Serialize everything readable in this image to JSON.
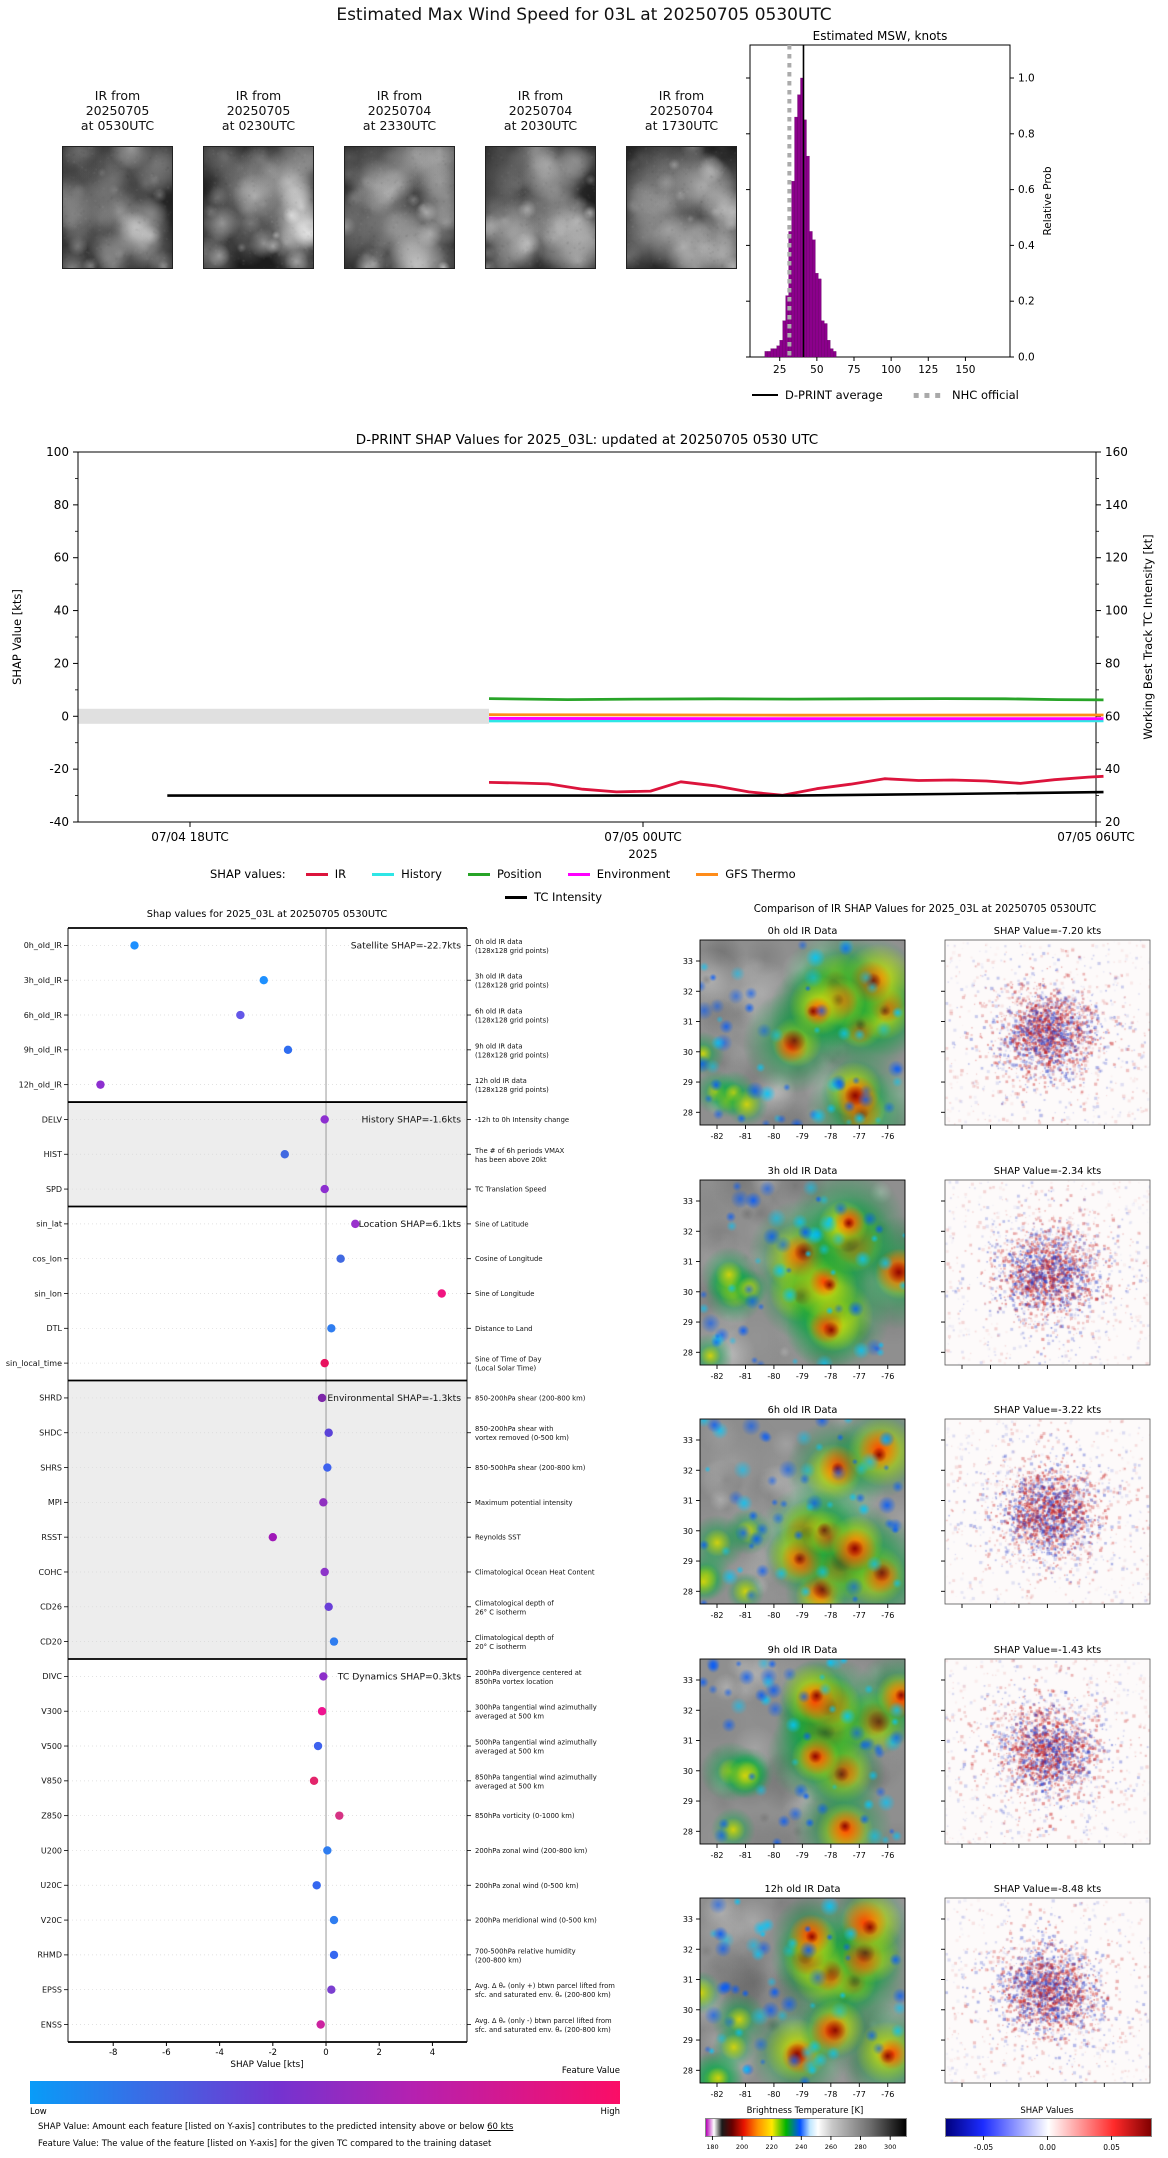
{
  "page": {
    "title": "Estimated Max Wind Speed for 03L at 20250705 0530UTC"
  },
  "ir_thumbnails": {
    "items": [
      {
        "lines": [
          "IR from",
          "20250705",
          "at 0530UTC"
        ]
      },
      {
        "lines": [
          "IR from",
          "20250705",
          "at 0230UTC"
        ]
      },
      {
        "lines": [
          "IR from",
          "20250704",
          "at 2330UTC"
        ]
      },
      {
        "lines": [
          "IR from",
          "20250704",
          "at 2030UTC"
        ]
      },
      {
        "lines": [
          "IR from",
          "20250704",
          "at 1730UTC"
        ]
      }
    ]
  },
  "chart_data": [
    {
      "id": "msw_histogram",
      "type": "bar",
      "title": "Estimated MSW, knots",
      "ylabel": "Relative Prob",
      "xlim": [
        5,
        180
      ],
      "ylim": [
        0,
        1.12
      ],
      "xticks": [
        25,
        50,
        75,
        100,
        125,
        150
      ],
      "yticks": [
        0.0,
        0.2,
        0.4,
        0.6,
        0.8,
        1.0
      ],
      "bar_color": "#8B008B",
      "bin_width_kts": 2,
      "bins_kts": [
        16,
        18,
        20,
        22,
        24,
        26,
        28,
        30,
        32,
        34,
        36,
        38,
        40,
        42,
        44,
        46,
        48,
        50,
        52,
        54,
        56,
        58,
        60,
        62
      ],
      "rel_prob": [
        0.02,
        0.02,
        0.03,
        0.03,
        0.04,
        0.06,
        0.13,
        0.22,
        0.45,
        0.63,
        0.86,
        0.94,
        1.0,
        0.85,
        0.72,
        0.45,
        0.42,
        0.3,
        0.28,
        0.13,
        0.12,
        0.06,
        0.03,
        0.02
      ],
      "dprint_average_kts": 41,
      "nhc_official_kts": 31.5,
      "legend": [
        {
          "label": "D-PRINT average",
          "style": "solid-black-line"
        },
        {
          "label": "NHC official",
          "style": "gray-square-dashes"
        }
      ]
    },
    {
      "id": "shap_timeseries",
      "type": "line",
      "title": "D-PRINT SHAP Values for 2025_03L: updated at 20250705 0530 UTC",
      "ylabel_left": "SHAP Value [kts]",
      "ylabel_right": "Working Best Track TC Intensity [kt]",
      "xlabel": "2025",
      "ylim_left": [
        -40,
        100
      ],
      "yticks_left": [
        100,
        80,
        60,
        40,
        20,
        0,
        -20,
        -40
      ],
      "ylim_right": [
        20,
        160
      ],
      "yticks_right": [
        160,
        140,
        120,
        100,
        80,
        60,
        40,
        20
      ],
      "xtick_labels": [
        "07/04 18UTC",
        "07/05 00UTC",
        "07/05 06UTC"
      ],
      "xtick_hours": [
        0,
        6,
        12
      ],
      "zero_band": {
        "color": "#e0e0e0",
        "from_h": -1.5,
        "to_h": 3.96
      },
      "legend_label": "SHAP values:",
      "series": [
        {
          "name": "IR",
          "color": "#DC143C",
          "axis": "left",
          "x_h": [
            3.96,
            4.3,
            4.75,
            5.2,
            5.65,
            6.1,
            6.5,
            6.95,
            7.4,
            7.85,
            8.3,
            8.75,
            9.2,
            9.65,
            10.1,
            10.55,
            11.0,
            11.45,
            11.9,
            12.1
          ],
          "values": [
            -25.0,
            -25.2,
            -25.6,
            -27.6,
            -28.6,
            -28.3,
            -24.8,
            -26.3,
            -28.6,
            -29.9,
            -27.4,
            -25.7,
            -23.6,
            -24.3,
            -24.1,
            -24.5,
            -25.4,
            -24.0,
            -23.0,
            -22.7
          ]
        },
        {
          "name": "History",
          "color": "#2ee6e6",
          "axis": "left",
          "x_h": [
            3.96,
            8.0,
            12.1
          ],
          "values": [
            -1.8,
            -1.7,
            -1.7
          ]
        },
        {
          "name": "Position",
          "color": "#28a428",
          "axis": "left",
          "x_h": [
            3.96,
            5.0,
            6.0,
            7.0,
            8.0,
            9.0,
            10.0,
            10.8,
            11.5,
            12.1
          ],
          "values": [
            6.7,
            6.3,
            6.5,
            6.6,
            6.5,
            6.6,
            6.7,
            6.6,
            6.3,
            6.2
          ]
        },
        {
          "name": "Environment",
          "color": "#ff00ff",
          "axis": "left",
          "x_h": [
            3.96,
            8.0,
            12.1
          ],
          "values": [
            -0.8,
            -0.9,
            -0.9
          ]
        },
        {
          "name": "GFS Thermo",
          "color": "#ff8c1a",
          "axis": "left",
          "x_h": [
            3.96,
            8.0,
            12.1
          ],
          "values": [
            0.6,
            0.4,
            0.5
          ]
        },
        {
          "name": "TC Intensity",
          "color": "#000000",
          "axis": "right",
          "x_h": [
            -0.3,
            6.0,
            8.0,
            10.0,
            12.1
          ],
          "values": [
            30,
            30,
            30,
            30.6,
            31.3
          ]
        }
      ]
    },
    {
      "id": "shap_dotplot",
      "type": "scatter",
      "title": "Shap values for 2025_03L at 20250705 0530UTC",
      "xlabel": "SHAP Value [kts]",
      "xticks": [
        -8,
        -6,
        -4,
        -2,
        0,
        2,
        4
      ],
      "xlim": [
        -9.7,
        5.3
      ],
      "sections": [
        {
          "label": "Satellite SHAP=-22.7kts",
          "shaded": false,
          "features": [
            {
              "name": "0h_old_IR",
              "value": -7.2,
              "color": "#1e90ff",
              "desc": [
                "0h old IR data",
                "(128x128 grid points)"
              ]
            },
            {
              "name": "3h_old_IR",
              "value": -2.34,
              "color": "#1e90ff",
              "desc": [
                "3h old IR data",
                "(128x128 grid points)"
              ]
            },
            {
              "name": "6h_old_IR",
              "value": -3.22,
              "color": "#6457e8",
              "desc": [
                "6h old IR data",
                "(128x128 grid points)"
              ]
            },
            {
              "name": "9h_old_IR",
              "value": -1.43,
              "color": "#2f6df0",
              "desc": [
                "9h old IR data",
                "(128x128 grid points)"
              ]
            },
            {
              "name": "12h_old_IR",
              "value": -8.48,
              "color": "#8d2fd0",
              "desc": [
                "12h old IR data",
                "(128x128 grid points)"
              ]
            }
          ]
        },
        {
          "label": "History SHAP=-1.6kts",
          "shaded": true,
          "features": [
            {
              "name": "DELV",
              "value": -0.05,
              "color": "#8d2fd0",
              "desc": [
                "-12h to 0h Intensity change"
              ]
            },
            {
              "name": "HIST",
              "value": -1.55,
              "color": "#4169e1",
              "desc": [
                "The # of 6h periods VMAX",
                "has been above 20kt"
              ]
            },
            {
              "name": "SPD",
              "value": -0.05,
              "color": "#8d2fd0",
              "desc": [
                "TC Translation Speed"
              ]
            }
          ]
        },
        {
          "label": "Location SHAP=6.1kts",
          "shaded": false,
          "features": [
            {
              "name": "sin_lat",
              "value": 1.1,
              "color": "#9932cc",
              "desc": [
                "Sine of Latitude"
              ]
            },
            {
              "name": "cos_lon",
              "value": 0.55,
              "color": "#4169e1",
              "desc": [
                "Cosine of Longitude"
              ]
            },
            {
              "name": "sin_lon",
              "value": 4.35,
              "color": "#f01480",
              "desc": [
                "Sine of Longitude"
              ]
            },
            {
              "name": "DTL",
              "value": 0.2,
              "color": "#2f7df0",
              "desc": [
                "Distance to Land"
              ]
            },
            {
              "name": "sin_local_time",
              "value": -0.05,
              "color": "#e8125f",
              "desc": [
                "Sine of Time of Day",
                "(Local Solar Time)"
              ]
            }
          ]
        },
        {
          "label": "Environmental SHAP=-1.3kts",
          "shaded": true,
          "features": [
            {
              "name": "SHRD",
              "value": -0.15,
              "color": "#7d26a8",
              "desc": [
                "850-200hPa shear (200-800 km)"
              ]
            },
            {
              "name": "SHDC",
              "value": 0.1,
              "color": "#5b43d8",
              "desc": [
                "850-200hPa shear with",
                "vortex removed (0-500 km)"
              ]
            },
            {
              "name": "SHRS",
              "value": 0.05,
              "color": "#3e62ee",
              "desc": [
                "850-500hPa shear (200-800 km)"
              ]
            },
            {
              "name": "MPI",
              "value": -0.1,
              "color": "#9030c0",
              "desc": [
                "Maximum potential intensity"
              ]
            },
            {
              "name": "RSST",
              "value": -2.0,
              "color": "#a018b8",
              "desc": [
                "Reynolds SST"
              ]
            },
            {
              "name": "COHC",
              "value": -0.05,
              "color": "#8d35c9",
              "desc": [
                "Climatological Ocean Heat Content"
              ]
            },
            {
              "name": "CD26",
              "value": 0.1,
              "color": "#6a3fd8",
              "desc": [
                "Climatological depth of",
                "26° C isotherm"
              ]
            },
            {
              "name": "CD20",
              "value": 0.3,
              "color": "#2f7df0",
              "desc": [
                "Climatological depth of",
                "20° C isotherm"
              ]
            }
          ]
        },
        {
          "label": "TC Dynamics SHAP=0.3kts",
          "shaded": false,
          "features": [
            {
              "name": "DIVC",
              "value": -0.1,
              "color": "#8d2fc9",
              "desc": [
                "200hPa divergence centered at",
                "850hPa vortex location"
              ]
            },
            {
              "name": "V300",
              "value": -0.15,
              "color": "#ef1390",
              "desc": [
                "300hPa tangential wind azimuthally",
                "averaged at 500 km"
              ]
            },
            {
              "name": "V500",
              "value": -0.3,
              "color": "#3e62ee",
              "desc": [
                "500hPa tangential wind azimuthally",
                "averaged at 500 km"
              ]
            },
            {
              "name": "V850",
              "value": -0.45,
              "color": "#e3256b",
              "desc": [
                "850hPa tangential wind azimuthally",
                "averaged at 500 km"
              ]
            },
            {
              "name": "Z850",
              "value": 0.5,
              "color": "#d63384",
              "desc": [
                "850hPa vorticity (0-1000 km)"
              ]
            },
            {
              "name": "U200",
              "value": 0.05,
              "color": "#2f7df0",
              "desc": [
                "200hPa zonal wind (200-800 km)"
              ]
            },
            {
              "name": "U20C",
              "value": -0.35,
              "color": "#3567f0",
              "desc": [
                "200hPa zonal wind (0-500 km)"
              ]
            },
            {
              "name": "V20C",
              "value": 0.3,
              "color": "#2f7df0",
              "desc": [
                "200hPa meridional wind (0-500 km)"
              ]
            },
            {
              "name": "RHMD",
              "value": 0.3,
              "color": "#3567f0",
              "desc": [
                "700-500hPa relative humidity",
                "(200-800 km)"
              ]
            },
            {
              "name": "EPSS",
              "value": 0.2,
              "color": "#7b3fd0",
              "desc": [
                "Avg. Δ θₑ (only +) btwn parcel lifted from",
                "sfc. and saturated env. θₑ (200-800 km)"
              ]
            },
            {
              "name": "ENSS",
              "value": -0.2,
              "color": "#cc22a0",
              "desc": [
                "Avg. Δ θₑ (only -) btwn parcel lifted from",
                "sfc. and saturated env. θₑ (200-800 km)"
              ]
            }
          ]
        }
      ]
    },
    {
      "id": "ir_shap_comparison",
      "type": "heatmap",
      "title": "Comparison of IR SHAP Values for 2025_03L at 20250705 0530UTC",
      "lat_ticks": [
        33,
        32,
        31,
        30,
        29,
        28
      ],
      "lon_ticks": [
        -82,
        -81,
        -80,
        -79,
        -78,
        -77,
        -76
      ],
      "rows": [
        {
          "ir_title": "0h old IR Data",
          "shap_title": "SHAP Value=-7.20 kts"
        },
        {
          "ir_title": "3h old IR Data",
          "shap_title": "SHAP Value=-2.34 kts"
        },
        {
          "ir_title": "6h old IR Data",
          "shap_title": "SHAP Value=-3.22 kts"
        },
        {
          "ir_title": "9h old IR Data",
          "shap_title": "SHAP Value=-1.43 kts"
        },
        {
          "ir_title": "12h old IR Data",
          "shap_title": "SHAP Value=-8.48 kts"
        }
      ]
    }
  ],
  "feature_value_bar": {
    "title": "Feature Value",
    "low": "Low",
    "high": "High",
    "stops": [
      [
        "#089cf8",
        0
      ],
      [
        "#7433d0",
        42
      ],
      [
        "#b521b0",
        65
      ],
      [
        "#fb0d66",
        100
      ]
    ]
  },
  "footnotes": {
    "shap_prefix": "SHAP Value: Amount each feature [listed on Y-axis] contributes to the predicted intensity above or below ",
    "shap_underlined": "60 kts",
    "feature": "Feature Value: The value of the feature [listed on Y-axis] for the given TC compared to the training dataset"
  },
  "colorbars": {
    "brightness": {
      "title": "Brightness Temperature [K]",
      "range": [
        175,
        310
      ],
      "ticks": [
        180,
        200,
        220,
        240,
        260,
        280,
        300
      ],
      "stops": [
        [
          "#b400b4",
          0
        ],
        [
          "#ffffff",
          4
        ],
        [
          "#1a1a1a",
          8
        ],
        [
          "#660000",
          13
        ],
        [
          "#e81400",
          19
        ],
        [
          "#ff9100",
          26
        ],
        [
          "#ffe900",
          33
        ],
        [
          "#00b400",
          40
        ],
        [
          "#0050ff",
          47
        ],
        [
          "#bfe6ff",
          52
        ],
        [
          "#ffffff",
          56
        ],
        [
          "#c8c8c8",
          63
        ],
        [
          "#6e6e6e",
          82
        ],
        [
          "#000000",
          100
        ]
      ]
    },
    "shap": {
      "title": "SHAP Values",
      "range": [
        -0.08,
        0.08
      ],
      "tick_values": [
        -0.05,
        0,
        0.05
      ],
      "tick_labels": [
        "-0.05",
        "0.00",
        "0.05"
      ],
      "stops": [
        [
          "#00007f",
          0
        ],
        [
          "#1c2cff",
          18
        ],
        [
          "#ffffff",
          50
        ],
        [
          "#ff2a2a",
          82
        ],
        [
          "#800000",
          100
        ]
      ]
    }
  }
}
